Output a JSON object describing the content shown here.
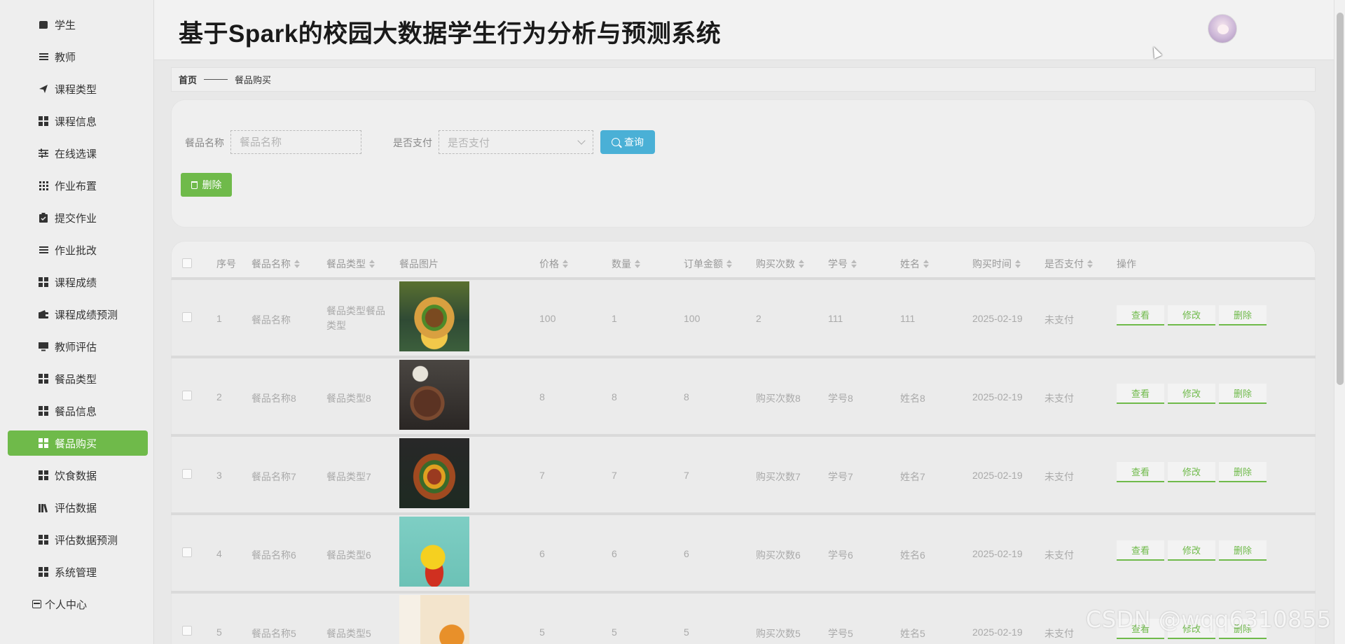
{
  "app": {
    "title": "基于Spark的校园大数据学生行为分析与预测系统"
  },
  "sidebar": {
    "items": [
      {
        "label": "学生",
        "icon": "chat-icon"
      },
      {
        "label": "教师",
        "icon": "list-icon"
      },
      {
        "label": "课程类型",
        "icon": "send-icon"
      },
      {
        "label": "课程信息",
        "icon": "grid-icon"
      },
      {
        "label": "在线选课",
        "icon": "sliders-icon"
      },
      {
        "label": "作业布置",
        "icon": "apps-icon"
      },
      {
        "label": "提交作业",
        "icon": "clipboard-icon"
      },
      {
        "label": "作业批改",
        "icon": "list-icon"
      },
      {
        "label": "课程成绩",
        "icon": "grid-icon"
      },
      {
        "label": "课程成绩预测",
        "icon": "wallet-icon"
      },
      {
        "label": "教师评估",
        "icon": "monitor-icon"
      },
      {
        "label": "餐品类型",
        "icon": "grid-icon"
      },
      {
        "label": "餐品信息",
        "icon": "grid-icon"
      },
      {
        "label": "餐品购买",
        "icon": "grid-icon",
        "active": true
      },
      {
        "label": "饮食数据",
        "icon": "grid-icon"
      },
      {
        "label": "评估数据",
        "icon": "library-icon"
      },
      {
        "label": "评估数据预测",
        "icon": "grid-icon"
      },
      {
        "label": "系统管理",
        "icon": "grid-icon"
      }
    ],
    "personal": {
      "label": "个人中心",
      "icon": "profile-icon"
    },
    "active_color": "#6fba4a"
  },
  "breadcrumb": {
    "home": "首页",
    "current": "餐品购买"
  },
  "search": {
    "name_label": "餐品名称",
    "name_placeholder": "餐品名称",
    "name_value": "",
    "paid_label": "是否支付",
    "paid_placeholder": "是否支付",
    "query_label": "查询",
    "delete_label": "删除",
    "query_color": "#4ab0d6",
    "delete_color": "#6fba4a"
  },
  "table": {
    "columns": [
      {
        "label": "序号",
        "sortable": false
      },
      {
        "label": "餐品名称",
        "sortable": true
      },
      {
        "label": "餐品类型",
        "sortable": true
      },
      {
        "label": "餐品图片",
        "sortable": false
      },
      {
        "label": "价格",
        "sortable": true
      },
      {
        "label": "数量",
        "sortable": true
      },
      {
        "label": "订单金额",
        "sortable": true
      },
      {
        "label": "购买次数",
        "sortable": true
      },
      {
        "label": "学号",
        "sortable": true
      },
      {
        "label": "姓名",
        "sortable": true
      },
      {
        "label": "购买时间",
        "sortable": true
      },
      {
        "label": "是否支付",
        "sortable": true
      },
      {
        "label": "操作",
        "sortable": false
      }
    ],
    "rows": [
      {
        "index": "1",
        "name": "餐品名称",
        "type": "餐品类型餐品类型",
        "price": "100",
        "qty": "1",
        "amount": "100",
        "times": "2",
        "student_no": "111",
        "student_name": "111",
        "time": "2025-02-19",
        "paid": "未支付"
      },
      {
        "index": "2",
        "name": "餐品名称8",
        "type": "餐品类型8",
        "price": "8",
        "qty": "8",
        "amount": "8",
        "times": "购买次数8",
        "student_no": "学号8",
        "student_name": "姓名8",
        "time": "2025-02-19",
        "paid": "未支付"
      },
      {
        "index": "3",
        "name": "餐品名称7",
        "type": "餐品类型7",
        "price": "7",
        "qty": "7",
        "amount": "7",
        "times": "购买次数7",
        "student_no": "学号7",
        "student_name": "姓名7",
        "time": "2025-02-19",
        "paid": "未支付"
      },
      {
        "index": "4",
        "name": "餐品名称6",
        "type": "餐品类型6",
        "price": "6",
        "qty": "6",
        "amount": "6",
        "times": "购买次数6",
        "student_no": "学号6",
        "student_name": "姓名6",
        "time": "2025-02-19",
        "paid": "未支付"
      },
      {
        "index": "5",
        "name": "餐品名称5",
        "type": "餐品类型5",
        "price": "5",
        "qty": "5",
        "amount": "5",
        "times": "购买次数5",
        "student_no": "学号5",
        "student_name": "姓名5",
        "time": "2025-02-19",
        "paid": "未支付"
      }
    ],
    "actions": {
      "view": "查看",
      "edit": "修改",
      "delete": "删除"
    },
    "action_color": "#6fba4a"
  },
  "watermark": "CSDN @wqq6310855"
}
